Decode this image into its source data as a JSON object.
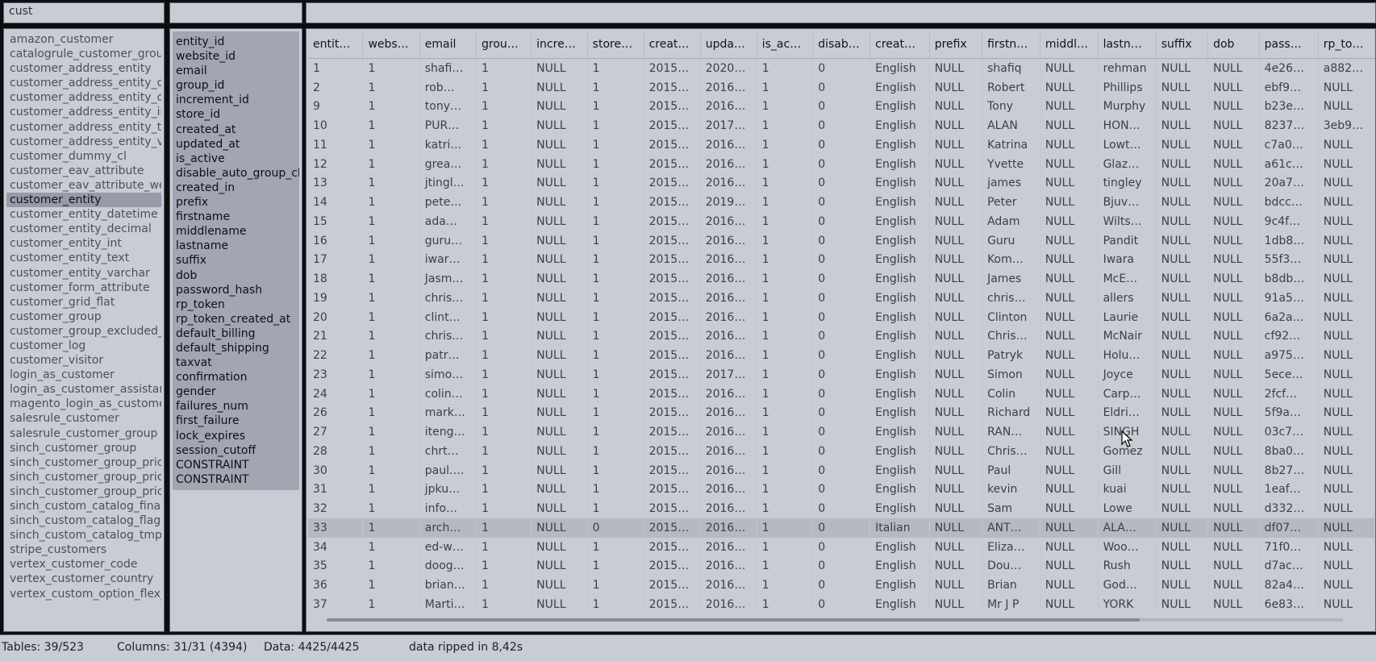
{
  "filters": {
    "tables_filter": "cust",
    "columns_filter": "",
    "data_filter": ""
  },
  "tables": {
    "items": [
      "amazon_customer",
      "catalogrule_customer_group",
      "customer_address_entity",
      "customer_address_entity_datetime",
      "customer_address_entity_decimal",
      "customer_address_entity_int",
      "customer_address_entity_text",
      "customer_address_entity_varchar",
      "customer_dummy_cl",
      "customer_eav_attribute",
      "customer_eav_attribute_website",
      "customer_entity",
      "customer_entity_datetime",
      "customer_entity_decimal",
      "customer_entity_int",
      "customer_entity_text",
      "customer_entity_varchar",
      "customer_form_attribute",
      "customer_grid_flat",
      "customer_group",
      "customer_group_excluded_website",
      "customer_log",
      "customer_visitor",
      "login_as_customer",
      "login_as_customer_assistance_allowed",
      "magento_login_as_customer_log",
      "salesrule_customer",
      "salesrule_customer_group",
      "sinch_customer_group",
      "sinch_customer_group_price",
      "sinch_customer_group_price_tmp",
      "sinch_customer_group_price_cl",
      "sinch_custom_catalog_final_tmp",
      "sinch_custom_catalog_flag",
      "sinch_custom_catalog_tmp",
      "stripe_customers",
      "vertex_customer_code",
      "vertex_customer_country",
      "vertex_custom_option_flex_field"
    ],
    "selected_index": 11
  },
  "columns": {
    "items": [
      "entity_id",
      "website_id",
      "email",
      "group_id",
      "increment_id",
      "store_id",
      "created_at",
      "updated_at",
      "is_active",
      "disable_auto_group_change",
      "created_in",
      "prefix",
      "firstname",
      "middlename",
      "lastname",
      "suffix",
      "dob",
      "password_hash",
      "rp_token",
      "rp_token_created_at",
      "default_billing",
      "default_shipping",
      "taxvat",
      "confirmation",
      "gender",
      "failures_num",
      "first_failure",
      "lock_expires",
      "session_cutoff",
      "CONSTRAINT",
      "CONSTRAINT"
    ]
  },
  "grid": {
    "headers": [
      "entit…",
      "webs…",
      "email",
      "grou…",
      "incre…",
      "store…",
      "creat…",
      "upda…",
      "is_ac…",
      "disab…",
      "creat…",
      "prefix",
      "firstn…",
      "middl…",
      "lastn…",
      "suffix",
      "dob",
      "pass…",
      "rp_to…"
    ],
    "highlighted_row": 24,
    "rows": [
      [
        "1",
        "1",
        "shafi…",
        "1",
        "NULL",
        "1",
        "2015…",
        "2020…",
        "1",
        "0",
        "English",
        "NULL",
        "shafiq",
        "NULL",
        "rehman",
        "NULL",
        "NULL",
        "4e26…",
        "a882…"
      ],
      [
        "2",
        "1",
        "rob…",
        "1",
        "NULL",
        "1",
        "2015…",
        "2016…",
        "1",
        "0",
        "English",
        "NULL",
        "Robert",
        "NULL",
        "Phillips",
        "NULL",
        "NULL",
        "ebf9…",
        "NULL"
      ],
      [
        "9",
        "1",
        "tony…",
        "1",
        "NULL",
        "1",
        "2015…",
        "2016…",
        "1",
        "0",
        "English",
        "NULL",
        "Tony",
        "NULL",
        "Murphy",
        "NULL",
        "NULL",
        "b23e…",
        "NULL"
      ],
      [
        "10",
        "1",
        "PUR…",
        "1",
        "NULL",
        "1",
        "2015…",
        "2017…",
        "1",
        "0",
        "English",
        "NULL",
        "ALAN",
        "NULL",
        "HON…",
        "NULL",
        "NULL",
        "8237…",
        "3eb9…"
      ],
      [
        "11",
        "1",
        "katri…",
        "1",
        "NULL",
        "1",
        "2015…",
        "2016…",
        "1",
        "0",
        "English",
        "NULL",
        "Katrina",
        "NULL",
        "Lowt…",
        "NULL",
        "NULL",
        "c7a0…",
        "NULL"
      ],
      [
        "12",
        "1",
        "grea…",
        "1",
        "NULL",
        "1",
        "2015…",
        "2016…",
        "1",
        "0",
        "English",
        "NULL",
        "Yvette",
        "NULL",
        "Glaz…",
        "NULL",
        "NULL",
        "a61c…",
        "NULL"
      ],
      [
        "13",
        "1",
        "jtingl…",
        "1",
        "NULL",
        "1",
        "2015…",
        "2016…",
        "1",
        "0",
        "English",
        "NULL",
        "james",
        "NULL",
        "tingley",
        "NULL",
        "NULL",
        "20a7…",
        "NULL"
      ],
      [
        "14",
        "1",
        "pete…",
        "1",
        "NULL",
        "1",
        "2015…",
        "2019…",
        "1",
        "0",
        "English",
        "NULL",
        "Peter",
        "NULL",
        "Bjuv…",
        "NULL",
        "NULL",
        "bdcc…",
        "NULL"
      ],
      [
        "15",
        "1",
        "ada…",
        "1",
        "NULL",
        "1",
        "2015…",
        "2016…",
        "1",
        "0",
        "English",
        "NULL",
        "Adam",
        "NULL",
        "Wilts…",
        "NULL",
        "NULL",
        "9c4f…",
        "NULL"
      ],
      [
        "16",
        "1",
        "guru…",
        "1",
        "NULL",
        "1",
        "2015…",
        "2016…",
        "1",
        "0",
        "English",
        "NULL",
        "Guru",
        "NULL",
        "Pandit",
        "NULL",
        "NULL",
        "1db8…",
        "NULL"
      ],
      [
        "17",
        "1",
        "iwar…",
        "1",
        "NULL",
        "1",
        "2015…",
        "2016…",
        "1",
        "0",
        "English",
        "NULL",
        "Kom…",
        "NULL",
        "Iwara",
        "NULL",
        "NULL",
        "55f3…",
        "NULL"
      ],
      [
        "18",
        "1",
        "Jasm…",
        "1",
        "NULL",
        "1",
        "2015…",
        "2016…",
        "1",
        "0",
        "English",
        "NULL",
        "James",
        "NULL",
        "McE…",
        "NULL",
        "NULL",
        "b8db…",
        "NULL"
      ],
      [
        "19",
        "1",
        "chris…",
        "1",
        "NULL",
        "1",
        "2015…",
        "2016…",
        "1",
        "0",
        "English",
        "NULL",
        "chris…",
        "NULL",
        "allers",
        "NULL",
        "NULL",
        "91a5…",
        "NULL"
      ],
      [
        "20",
        "1",
        "clint…",
        "1",
        "NULL",
        "1",
        "2015…",
        "2016…",
        "1",
        "0",
        "English",
        "NULL",
        "Clinton",
        "NULL",
        "Laurie",
        "NULL",
        "NULL",
        "6a2a…",
        "NULL"
      ],
      [
        "21",
        "1",
        "chris…",
        "1",
        "NULL",
        "1",
        "2015…",
        "2016…",
        "1",
        "0",
        "English",
        "NULL",
        "Chris…",
        "NULL",
        "McNair",
        "NULL",
        "NULL",
        "cf92…",
        "NULL"
      ],
      [
        "22",
        "1",
        "patr…",
        "1",
        "NULL",
        "1",
        "2015…",
        "2016…",
        "1",
        "0",
        "English",
        "NULL",
        "Patryk",
        "NULL",
        "Holu…",
        "NULL",
        "NULL",
        "a975…",
        "NULL"
      ],
      [
        "23",
        "1",
        "simo…",
        "1",
        "NULL",
        "1",
        "2015…",
        "2017…",
        "1",
        "0",
        "English",
        "NULL",
        "Simon",
        "NULL",
        "Joyce",
        "NULL",
        "NULL",
        "5ece…",
        "NULL"
      ],
      [
        "24",
        "1",
        "colin…",
        "1",
        "NULL",
        "1",
        "2015…",
        "2016…",
        "1",
        "0",
        "English",
        "NULL",
        "Colin",
        "NULL",
        "Carp…",
        "NULL",
        "NULL",
        "2fcf…",
        "NULL"
      ],
      [
        "26",
        "1",
        "mark…",
        "1",
        "NULL",
        "1",
        "2015…",
        "2016…",
        "1",
        "0",
        "English",
        "NULL",
        "Richard",
        "NULL",
        "Eldri…",
        "NULL",
        "NULL",
        "5f9a…",
        "NULL"
      ],
      [
        "27",
        "1",
        "iteng…",
        "1",
        "NULL",
        "1",
        "2015…",
        "2016…",
        "1",
        "0",
        "English",
        "NULL",
        "RAN…",
        "NULL",
        "SINGH",
        "NULL",
        "NULL",
        "03c7…",
        "NULL"
      ],
      [
        "28",
        "1",
        "chrt…",
        "1",
        "NULL",
        "1",
        "2015…",
        "2016…",
        "1",
        "0",
        "English",
        "NULL",
        "Chris…",
        "NULL",
        "Gomez",
        "NULL",
        "NULL",
        "8ba0…",
        "NULL"
      ],
      [
        "30",
        "1",
        "paul.…",
        "1",
        "NULL",
        "1",
        "2015…",
        "2016…",
        "1",
        "0",
        "English",
        "NULL",
        "Paul",
        "NULL",
        "Gill",
        "NULL",
        "NULL",
        "8b27…",
        "NULL"
      ],
      [
        "31",
        "1",
        "jpku…",
        "1",
        "NULL",
        "1",
        "2015…",
        "2016…",
        "1",
        "0",
        "English",
        "NULL",
        "kevin",
        "NULL",
        "kuai",
        "NULL",
        "NULL",
        "1eaf…",
        "NULL"
      ],
      [
        "32",
        "1",
        "info…",
        "1",
        "NULL",
        "1",
        "2015…",
        "2016…",
        "1",
        "0",
        "English",
        "NULL",
        "Sam",
        "NULL",
        "Lowe",
        "NULL",
        "NULL",
        "d332…",
        "NULL"
      ],
      [
        "33",
        "1",
        "arch…",
        "1",
        "NULL",
        "0",
        "2015…",
        "2016…",
        "1",
        "0",
        "Italian",
        "NULL",
        "ANT…",
        "NULL",
        "ALA…",
        "NULL",
        "NULL",
        "df07…",
        "NULL"
      ],
      [
        "34",
        "1",
        "ed-w…",
        "1",
        "NULL",
        "1",
        "2015…",
        "2016…",
        "1",
        "0",
        "English",
        "NULL",
        "Eliza…",
        "NULL",
        "Woo…",
        "NULL",
        "NULL",
        "71f0…",
        "NULL"
      ],
      [
        "35",
        "1",
        "doog…",
        "1",
        "NULL",
        "1",
        "2015…",
        "2016…",
        "1",
        "0",
        "English",
        "NULL",
        "Dou…",
        "NULL",
        "Rush",
        "NULL",
        "NULL",
        "d7ac…",
        "NULL"
      ],
      [
        "36",
        "1",
        "brian…",
        "1",
        "NULL",
        "1",
        "2015…",
        "2016…",
        "1",
        "0",
        "English",
        "NULL",
        "Brian",
        "NULL",
        "God…",
        "NULL",
        "NULL",
        "82a4…",
        "NULL"
      ],
      [
        "37",
        "1",
        "Marti…",
        "1",
        "NULL",
        "1",
        "2015…",
        "2016…",
        "1",
        "0",
        "English",
        "NULL",
        "Mr J P",
        "NULL",
        "YORK",
        "NULL",
        "NULL",
        "6e83…",
        "NULL"
      ]
    ]
  },
  "status": {
    "tables": "Tables: 39/523",
    "columns": "Columns: 31/31 (4394)",
    "data": "Data: 4425/4425",
    "message": "data ripped in 8,42s"
  }
}
